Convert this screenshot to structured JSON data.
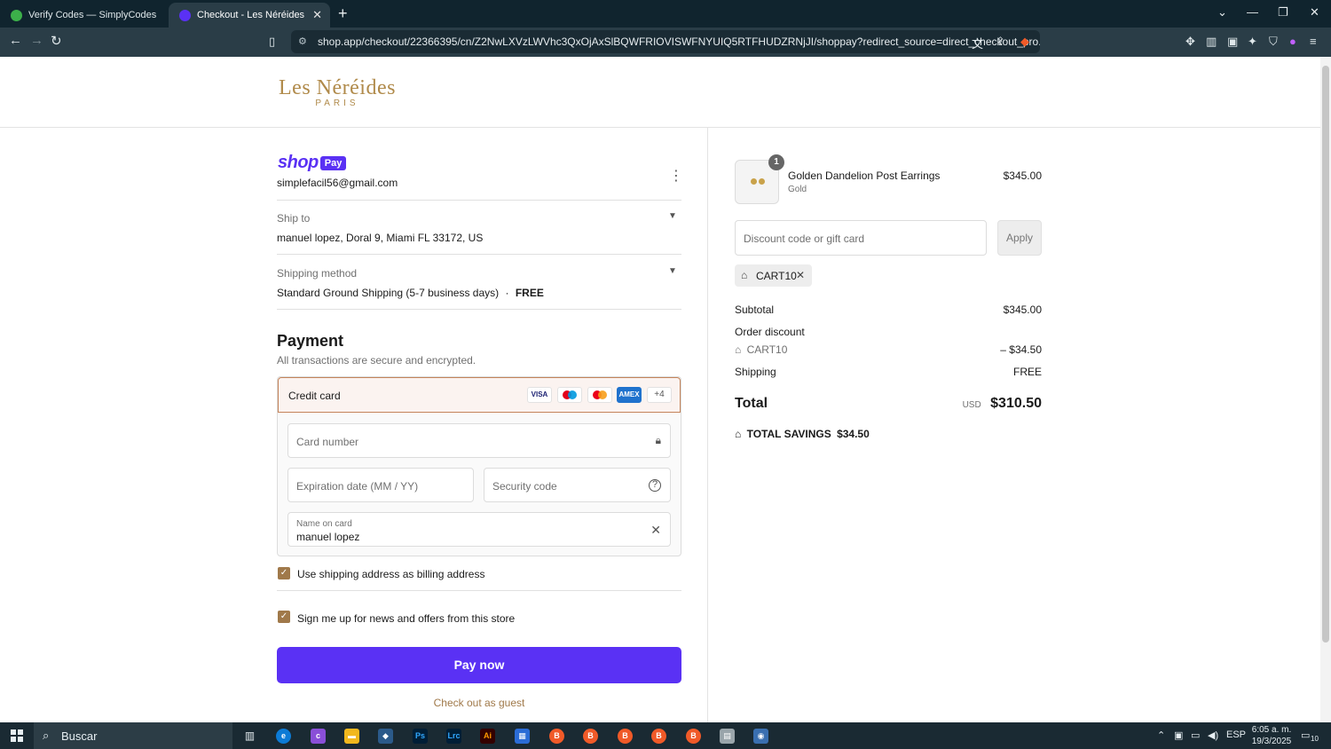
{
  "browser": {
    "tabs": [
      {
        "title": "Verify Codes — SimplyCodes",
        "active": false
      },
      {
        "title": "Checkout - Les Néréides",
        "active": true
      }
    ],
    "url": "shop.app/checkout/22366395/cn/Z2NwLXVzLWVhc3QxOjAxSlBQWFRIOVISWFNYUIQ5RTFHUDZRNjJI/shoppay?redirect_source=direct_checkout_pro..."
  },
  "header": {
    "brand_line1": "Les Néréides",
    "brand_line2": "PARIS"
  },
  "account": {
    "shop_text": "shop",
    "pay_badge": "Pay",
    "email": "simplefacil56@gmail.com"
  },
  "ship_to": {
    "label": "Ship to",
    "value": "manuel lopez, Doral 9, Miami FL 33172, US"
  },
  "shipping_method": {
    "label": "Shipping method",
    "value": "Standard Ground Shipping (5-7 business days)",
    "separator": "·",
    "price": "FREE"
  },
  "payment": {
    "title": "Payment",
    "subtitle": "All transactions are secure and encrypted.",
    "method_label": "Credit card",
    "card_brands": [
      "VISA",
      "maestro",
      "mastercard",
      "AMEX"
    ],
    "more_brands": "+4",
    "card_number_placeholder": "Card number",
    "expiration_placeholder": "Expiration date (MM / YY)",
    "security_placeholder": "Security code",
    "name_label": "Name on card",
    "name_value": "manuel lopez"
  },
  "options": {
    "billing_same": "Use shipping address as billing address",
    "newsletter": "Sign me up for news and offers from this store"
  },
  "actions": {
    "pay_now": "Pay now",
    "guest": "Check out as guest"
  },
  "summary": {
    "item": {
      "quantity": "1",
      "name": "Golden Dandelion Post Earrings",
      "variant": "Gold",
      "price": "$345.00"
    },
    "discount_placeholder": "Discount code or gift card",
    "apply_label": "Apply",
    "applied_code": "CART10",
    "subtotal_label": "Subtotal",
    "subtotal_value": "$345.00",
    "order_discount_label": "Order discount",
    "discount_code": "CART10",
    "discount_value": "– $34.50",
    "shipping_label": "Shipping",
    "shipping_value": "FREE",
    "total_label": "Total",
    "currency": "USD",
    "total_value": "$310.50",
    "savings_label": "TOTAL SAVINGS",
    "savings_value": "$34.50"
  },
  "taskbar": {
    "search_text": "Buscar",
    "language": "ESP",
    "time": "6:05 a. m.",
    "date": "19/3/2025",
    "notifications": "10"
  },
  "colors": {
    "shop_purple": "#5a31f4",
    "accent_gold": "#a0794a",
    "brand_gold": "#b08a4a"
  }
}
